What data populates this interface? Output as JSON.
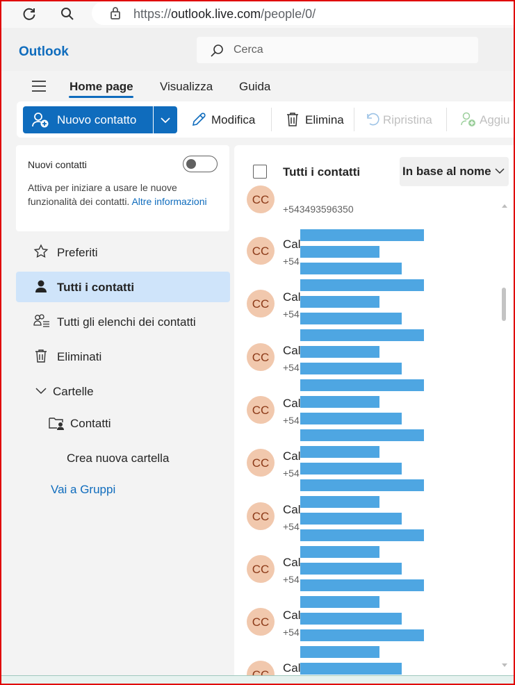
{
  "browser": {
    "url_domain": "outlook.live.com",
    "url_path": "/people/0/",
    "url_scheme": "https://"
  },
  "app": {
    "name": "Outlook"
  },
  "search": {
    "placeholder": "Cerca"
  },
  "tabs": [
    {
      "label": "Home page",
      "active": true
    },
    {
      "label": "Visualizza"
    },
    {
      "label": "Guida"
    }
  ],
  "ribbon": {
    "new_contact": "Nuovo contatto",
    "edit": "Modifica",
    "delete": "Elimina",
    "restore": "Ripristina",
    "add": "Aggiu"
  },
  "banner": {
    "title": "Nuovi contatti",
    "desc": "Attiva per iniziare a usare le nuove funzionalità dei contatti.",
    "link": "Altre informazioni",
    "toggle_on": false
  },
  "nav": {
    "favorites": "Preferiti",
    "all_contacts": "Tutti i contatti",
    "all_lists": "Tutti gli elenchi dei contatti",
    "deleted": "Eliminati",
    "folders": "Cartelle",
    "contacts_folder": "Contatti",
    "new_folder": "Crea nuova cartella",
    "groups": "Vai a Gruppi"
  },
  "list": {
    "header": "Tutti i contatti",
    "sort": "In base al nome",
    "first_phone": "+543493596350",
    "first_initials": "CC",
    "contacts": [
      {
        "initials": "CC",
        "name": "Cal",
        "phone": "+54"
      },
      {
        "initials": "CC",
        "name": "Cal",
        "phone": "+54"
      },
      {
        "initials": "CC",
        "name": "Cal",
        "phone": "+54"
      },
      {
        "initials": "CC",
        "name": "Cal",
        "phone": "+54"
      },
      {
        "initials": "CC",
        "name": "Cal",
        "phone": "+54"
      },
      {
        "initials": "CC",
        "name": "Cal",
        "phone": "+54"
      },
      {
        "initials": "CC",
        "name": "Cal",
        "phone": "+54"
      },
      {
        "initials": "CC",
        "name": "Cal",
        "phone": "+54"
      },
      {
        "initials": "CC",
        "name": "Cal",
        "phone": ""
      }
    ]
  },
  "colors": {
    "accent": "#0f6cbd",
    "avatar_bg": "#f1c8ad",
    "avatar_text": "#8c3a18",
    "redaction": "#4ea6e2",
    "selected_nav": "#cfe4fa"
  }
}
